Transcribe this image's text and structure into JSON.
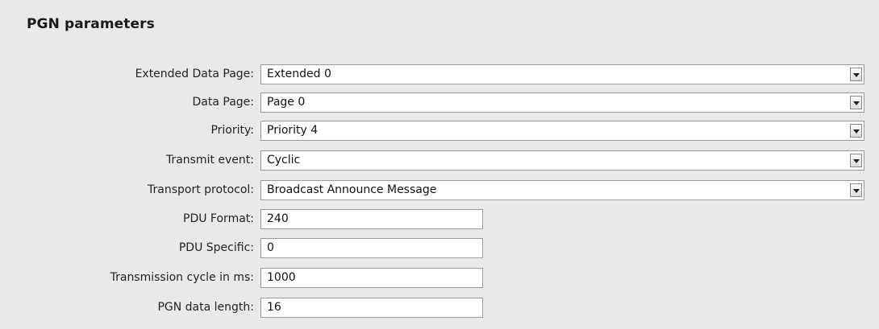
{
  "panel": {
    "title": "PGN parameters"
  },
  "fields": {
    "extended_data_page": {
      "label": "Extended Data Page:",
      "value": "Extended 0"
    },
    "data_page": {
      "label": "Data Page:",
      "value": "Page 0"
    },
    "priority": {
      "label": "Priority:",
      "value": "Priority 4"
    },
    "transmit_event": {
      "label": "Transmit event:",
      "value": "Cyclic"
    },
    "transport_protocol": {
      "label": "Transport protocol:",
      "value": "Broadcast Announce Message"
    },
    "pdu_format": {
      "label": "PDU Format:",
      "value": "240"
    },
    "pdu_specific": {
      "label": "PDU Specific:",
      "value": "0"
    },
    "transmission_cycle": {
      "label": "Transmission cycle in ms:",
      "value": "1000"
    },
    "pgn_data_length": {
      "label": "PGN data length:",
      "value": "16"
    }
  },
  "icons": {
    "dropdown": "chevron-down-icon"
  }
}
